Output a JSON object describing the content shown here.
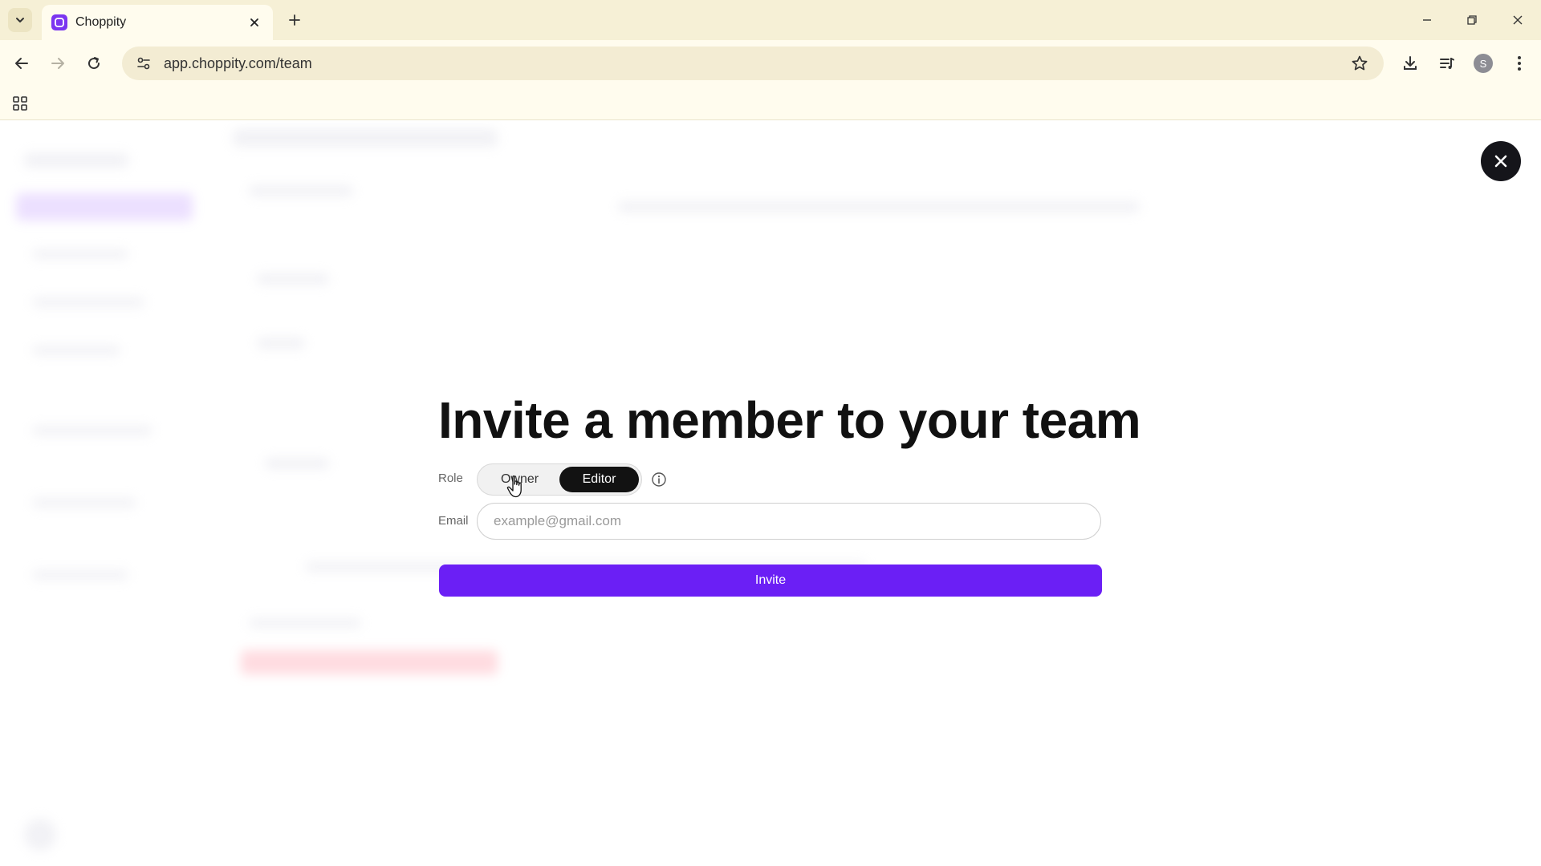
{
  "browser": {
    "tab_title": "Choppity",
    "url": "app.choppity.com/team",
    "profile_initial": "S"
  },
  "modal": {
    "title": "Invite a member to your team",
    "role_label": "Role",
    "role_options": [
      {
        "label": "Owner",
        "selected": false
      },
      {
        "label": "Editor",
        "selected": true
      }
    ],
    "email_label": "Email",
    "email_value": "",
    "email_placeholder": "example@gmail.com",
    "invite_label": "Invite"
  },
  "icons": {
    "close_modal": "close-icon",
    "role_info": "info-icon"
  },
  "colors": {
    "accent": "#6b1ff5",
    "selected_role_bg": "#121212",
    "chrome_bg": "#f6f0d6",
    "close_button_bg": "#15151a"
  }
}
